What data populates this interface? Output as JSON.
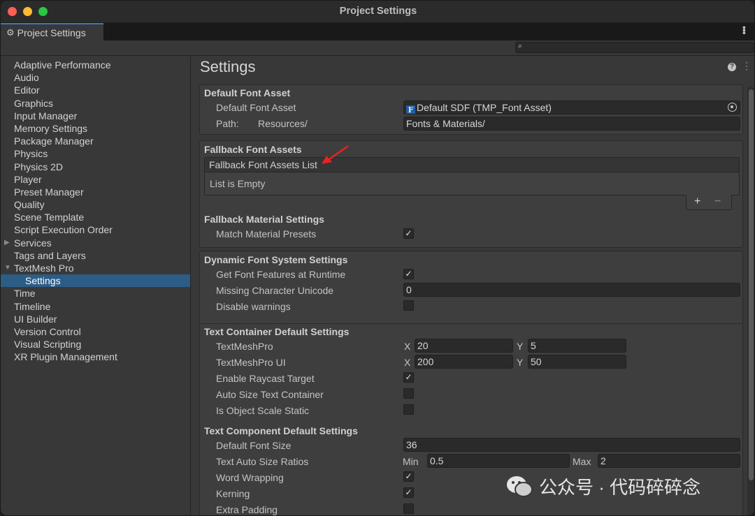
{
  "window": {
    "title": "Project Settings"
  },
  "tab": {
    "label": "Project Settings",
    "icon": "gear-icon"
  },
  "search": {
    "placeholder": ""
  },
  "sidebar": {
    "items": [
      {
        "label": "Adaptive Performance"
      },
      {
        "label": "Audio"
      },
      {
        "label": "Editor"
      },
      {
        "label": "Graphics"
      },
      {
        "label": "Input Manager"
      },
      {
        "label": "Memory Settings"
      },
      {
        "label": "Package Manager"
      },
      {
        "label": "Physics"
      },
      {
        "label": "Physics 2D"
      },
      {
        "label": "Player"
      },
      {
        "label": "Preset Manager"
      },
      {
        "label": "Quality"
      },
      {
        "label": "Scene Template"
      },
      {
        "label": "Script Execution Order"
      },
      {
        "label": "Services",
        "expandable": true,
        "expanded": false
      },
      {
        "label": "Tags and Layers"
      },
      {
        "label": "TextMesh Pro",
        "expandable": true,
        "expanded": true
      },
      {
        "label": "Settings",
        "child": true,
        "selected": true
      },
      {
        "label": "Time"
      },
      {
        "label": "Timeline"
      },
      {
        "label": "UI Builder"
      },
      {
        "label": "Version Control"
      },
      {
        "label": "Visual Scripting"
      },
      {
        "label": "XR Plugin Management"
      }
    ]
  },
  "main": {
    "title": "Settings",
    "default_font": {
      "heading": "Default Font Asset",
      "asset_label": "Default Font Asset",
      "asset_value": "Default SDF (TMP_Font Asset)",
      "asset_icon": "F",
      "path_label": "Path:",
      "path_prefix": "Resources/",
      "path_value": "Fonts & Materials/"
    },
    "fallback": {
      "heading": "Fallback Font Assets",
      "list_header": "Fallback Font Assets List",
      "list_empty": "List is Empty",
      "add": "+",
      "remove": "−",
      "material_heading": "Fallback Material Settings",
      "match_label": "Match Material Presets",
      "match_checked": true
    },
    "dynamic": {
      "heading": "Dynamic Font System Settings",
      "features_label": "Get Font Features at Runtime",
      "features_checked": true,
      "missing_label": "Missing Character Unicode",
      "missing_value": "0",
      "disable_label": "Disable warnings",
      "disable_checked": false
    },
    "container": {
      "heading": "Text Container Default Settings",
      "tmp_label": "TextMeshPro",
      "tmp_x_label": "X",
      "tmp_x": "20",
      "tmp_y_label": "Y",
      "tmp_y": "5",
      "tmpui_label": "TextMeshPro UI",
      "tmpui_x_label": "X",
      "tmpui_x": "200",
      "tmpui_y_label": "Y",
      "tmpui_y": "50",
      "raycast_label": "Enable Raycast Target",
      "raycast_checked": true,
      "autosize_label": "Auto Size Text Container",
      "autosize_checked": false,
      "scale_label": "Is Object Scale Static",
      "scale_checked": false
    },
    "component": {
      "heading": "Text Component Default Settings",
      "font_size_label": "Default Font Size",
      "font_size": "36",
      "ratios_label": "Text Auto Size Ratios",
      "min_label": "Min",
      "min_value": "0.5",
      "max_label": "Max",
      "max_value": "2",
      "wrap_label": "Word Wrapping",
      "wrap_checked": true,
      "kerning_label": "Kerning",
      "kerning_checked": true,
      "padding_label": "Extra Padding",
      "padding_checked": false
    }
  },
  "watermark": {
    "text": "公众号 · 代码碎碎念"
  },
  "colors": {
    "accent": "#2c5d87",
    "tab_accent": "#3a79bb",
    "annotation_arrow": "#e8231f"
  }
}
